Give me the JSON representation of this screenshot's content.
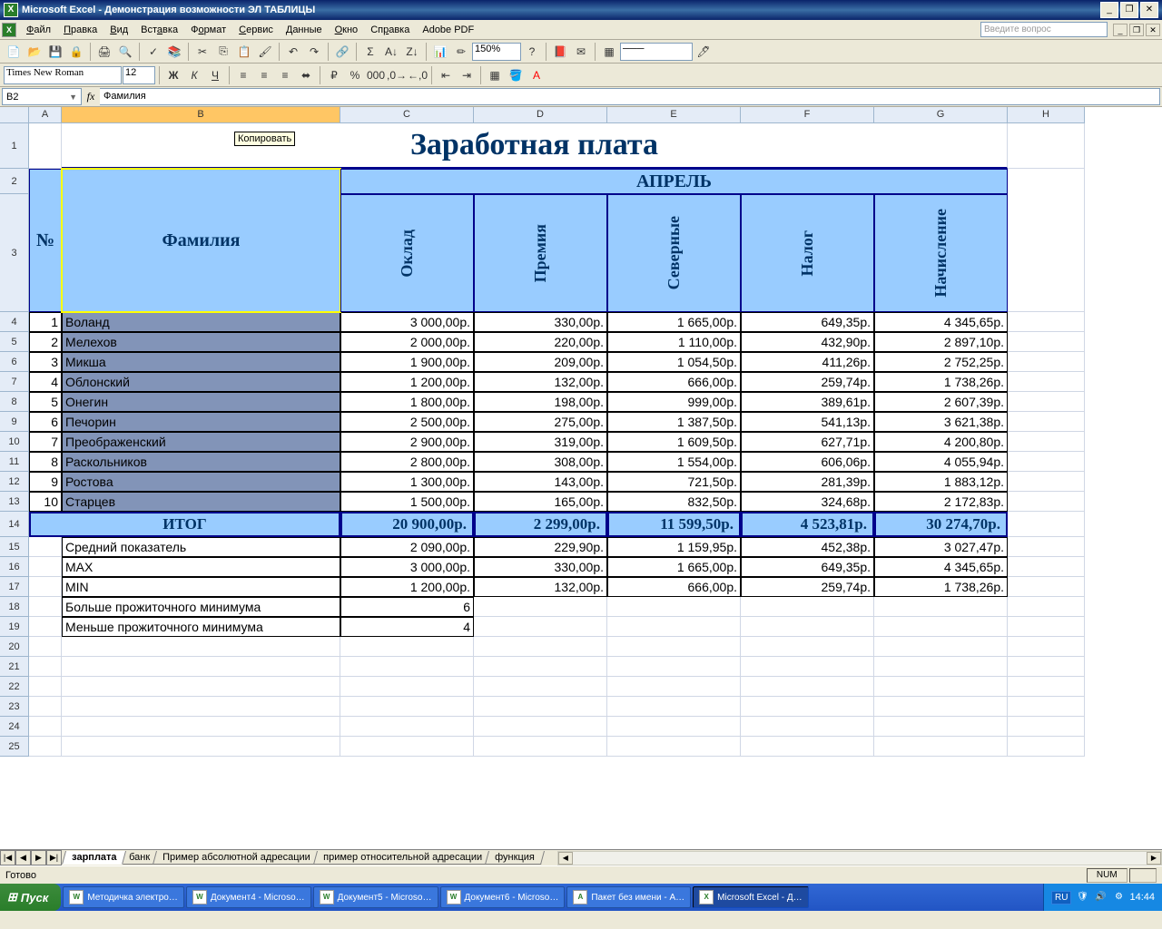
{
  "window": {
    "app": "Microsoft Excel",
    "doc": "Демонстрация возможности ЭЛ ТАБЛИЦЫ"
  },
  "menu": [
    "Файл",
    "Правка",
    "Вид",
    "Вставка",
    "Формат",
    "Сервис",
    "Данные",
    "Окно",
    "Справка",
    "Adobe PDF"
  ],
  "menu_underline_idx": [
    0,
    0,
    0,
    3,
    1,
    0,
    0,
    0,
    2,
    null
  ],
  "question_placeholder": "Введите вопрос",
  "tooltip": "Копировать",
  "font_name": "Times New Roman",
  "font_size": "12",
  "zoom": "150%",
  "namebox": "B2",
  "formula": "Фамилия",
  "cols": [
    "A",
    "B",
    "C",
    "D",
    "E",
    "F",
    "G",
    "H"
  ],
  "title": "Заработная плата",
  "month": "АПРЕЛЬ",
  "hdr_num": "№",
  "hdr_fam": "Фамилия",
  "subheads": [
    "Оклад",
    "Премия",
    "Северные",
    "Налог",
    "Начисление"
  ],
  "rows": [
    {
      "n": "1",
      "name": "Воланд",
      "v": [
        "3 000,00р.",
        "330,00р.",
        "1 665,00р.",
        "649,35р.",
        "4 345,65р."
      ]
    },
    {
      "n": "2",
      "name": "Мелехов",
      "v": [
        "2 000,00р.",
        "220,00р.",
        "1 110,00р.",
        "432,90р.",
        "2 897,10р."
      ]
    },
    {
      "n": "3",
      "name": "Микша",
      "v": [
        "1 900,00р.",
        "209,00р.",
        "1 054,50р.",
        "411,26р.",
        "2 752,25р."
      ]
    },
    {
      "n": "4",
      "name": "Облонский",
      "v": [
        "1 200,00р.",
        "132,00р.",
        "666,00р.",
        "259,74р.",
        "1 738,26р."
      ]
    },
    {
      "n": "5",
      "name": "Онегин",
      "v": [
        "1 800,00р.",
        "198,00р.",
        "999,00р.",
        "389,61р.",
        "2 607,39р."
      ]
    },
    {
      "n": "6",
      "name": "Печорин",
      "v": [
        "2 500,00р.",
        "275,00р.",
        "1 387,50р.",
        "541,13р.",
        "3 621,38р."
      ]
    },
    {
      "n": "7",
      "name": "Преображенский",
      "v": [
        "2 900,00р.",
        "319,00р.",
        "1 609,50р.",
        "627,71р.",
        "4 200,80р."
      ]
    },
    {
      "n": "8",
      "name": "Раскольников",
      "v": [
        "2 800,00р.",
        "308,00р.",
        "1 554,00р.",
        "606,06р.",
        "4 055,94р."
      ]
    },
    {
      "n": "9",
      "name": "Ростова",
      "v": [
        "1 300,00р.",
        "143,00р.",
        "721,50р.",
        "281,39р.",
        "1 883,12р."
      ]
    },
    {
      "n": "10",
      "name": "Старцев",
      "v": [
        "1 500,00р.",
        "165,00р.",
        "832,50р.",
        "324,68р.",
        "2 172,83р."
      ]
    }
  ],
  "itog_label": "ИТОГ",
  "itog": [
    "20 900,00р.",
    "2 299,00р.",
    "11 599,50р.",
    "4 523,81р.",
    "30 274,70р."
  ],
  "stats": [
    {
      "label": "Средний показатель",
      "v": [
        "2 090,00р.",
        "229,90р.",
        "1 159,95р.",
        "452,38р.",
        "3 027,47р."
      ]
    },
    {
      "label": "MAX",
      "v": [
        "3 000,00р.",
        "330,00р.",
        "1 665,00р.",
        "649,35р.",
        "4 345,65р."
      ]
    },
    {
      "label": "MIN",
      "v": [
        "1 200,00р.",
        "132,00р.",
        "666,00р.",
        "259,74р.",
        "1 738,26р."
      ]
    }
  ],
  "extra": [
    {
      "label": "Больше прожиточного минимума",
      "val": "6"
    },
    {
      "label": "Меньше прожиточного минимума",
      "val": "4"
    }
  ],
  "sheet_tabs": [
    "зарплата",
    "банк",
    "Пример абсолютной адресации",
    "пример относительной адресации",
    "функция"
  ],
  "active_tab": 0,
  "status": "Готово",
  "status_num": "NUM",
  "taskbar": {
    "start": "Пуск",
    "items": [
      "Методичка электро…",
      "Документ4 - Microso…",
      "Документ5 - Microso…",
      "Документ6 - Microso…",
      "Пакет без имени - A…",
      "Microsoft Excel - Д…"
    ],
    "active_item": 5,
    "lang": "RU",
    "time": "14:44"
  }
}
